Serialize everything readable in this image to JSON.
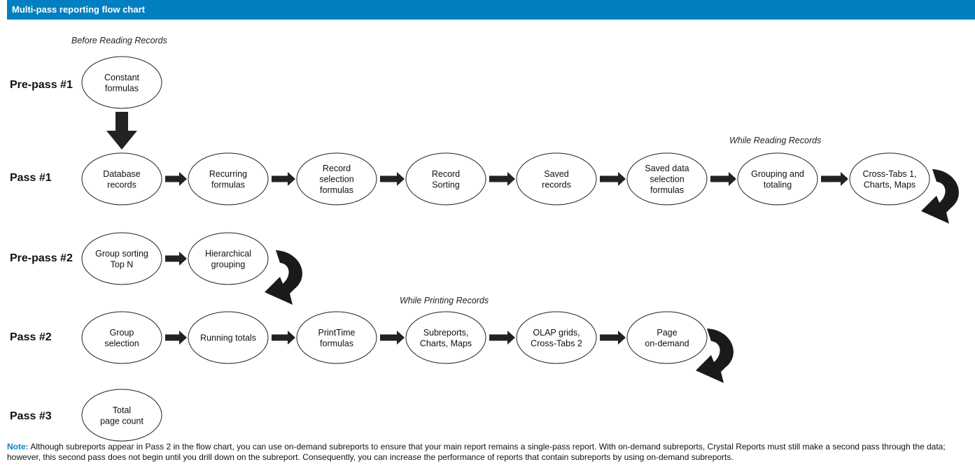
{
  "header": {
    "title": "Multi-pass reporting flow chart",
    "color": "#0080c0"
  },
  "section_labels": {
    "before_reading": "Before Reading Records",
    "while_reading": "While Reading Records",
    "while_printing": "While Printing Records"
  },
  "rows": [
    {
      "label": "Pre-pass #1",
      "nodes": [
        [
          "Constant",
          "formulas"
        ]
      ]
    },
    {
      "label": "Pass #1",
      "nodes": [
        [
          "Database",
          "records"
        ],
        [
          "Recurring",
          "formulas"
        ],
        [
          "Record",
          "selection",
          "formulas"
        ],
        [
          "Record",
          "Sorting"
        ],
        [
          "Saved",
          "records"
        ],
        [
          "Saved data",
          "selection",
          "formulas"
        ],
        [
          "Grouping and",
          "totaling"
        ],
        [
          "Cross-Tabs 1,",
          "Charts, Maps"
        ]
      ]
    },
    {
      "label": "Pre-pass #2",
      "nodes": [
        [
          "Group sorting",
          "Top N"
        ],
        [
          "Hierarchical",
          "grouping"
        ]
      ]
    },
    {
      "label": "Pass #2",
      "nodes": [
        [
          "Group",
          "selection"
        ],
        [
          "Running totals"
        ],
        [
          "PrintTime",
          "formulas"
        ],
        [
          "Subreports,",
          "Charts, Maps"
        ],
        [
          "OLAP grids,",
          "Cross-Tabs 2"
        ],
        [
          "Page",
          "on-demand"
        ]
      ]
    },
    {
      "label": "Pass #3",
      "nodes": [
        [
          "Total",
          "page count"
        ]
      ]
    }
  ],
  "note": {
    "label": "Note:",
    "text": " Although subreports appear in Pass 2 in the flow chart, you can use on-demand subreports to ensure that your main report remains a single-pass report. With on-demand subreports, Crystal Reports must still make a second pass through the data; however, this second pass does not begin until you drill down on the subreport. Consequently, you can increase the performance of reports that contain subreports by using on-demand subreports."
  }
}
